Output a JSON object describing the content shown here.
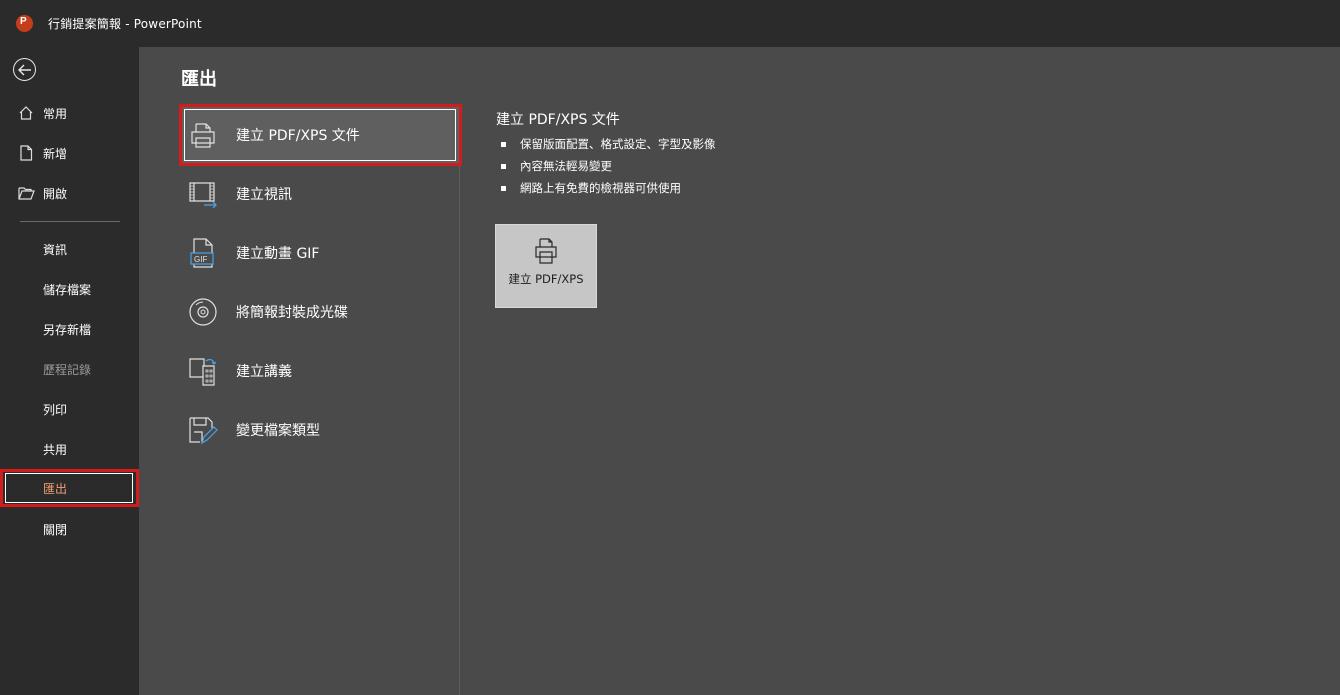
{
  "titlebar": {
    "title": "行銷提案簡報  -  PowerPoint"
  },
  "sidebar": {
    "items_top": [
      {
        "label": "常用",
        "icon": "home-icon"
      },
      {
        "label": "新增",
        "icon": "new-file-icon"
      },
      {
        "label": "開啟",
        "icon": "open-folder-icon"
      }
    ],
    "items": [
      {
        "label": "資訊",
        "state": "normal"
      },
      {
        "label": "儲存檔案",
        "state": "normal"
      },
      {
        "label": "另存新檔",
        "state": "normal"
      },
      {
        "label": "歷程記錄",
        "state": "disabled"
      },
      {
        "label": "列印",
        "state": "normal"
      },
      {
        "label": "共用",
        "state": "normal"
      },
      {
        "label": "匯出",
        "state": "active"
      },
      {
        "label": "關閉",
        "state": "normal"
      }
    ]
  },
  "main": {
    "title": "匯出",
    "options": [
      {
        "label": "建立 PDF/XPS 文件",
        "icon": "pdf-xps-icon",
        "selected": true
      },
      {
        "label": "建立視訊",
        "icon": "video-icon",
        "selected": false
      },
      {
        "label": "建立動畫 GIF",
        "icon": "gif-icon",
        "selected": false
      },
      {
        "label": "將簡報封裝成光碟",
        "icon": "cd-icon",
        "selected": false
      },
      {
        "label": "建立講義",
        "icon": "handout-icon",
        "selected": false
      },
      {
        "label": "變更檔案類型",
        "icon": "change-file-type-icon",
        "selected": false
      }
    ],
    "detail": {
      "title": "建立 PDF/XPS 文件",
      "bullets": [
        "保留版面配置、格式設定、字型及影像",
        "內容無法輕易變更",
        "網路上有免費的檢視器可供使用"
      ],
      "button_label": "建立 PDF/XPS"
    }
  },
  "colors": {
    "sidebar_bg": "#2b2b2b",
    "main_bg": "#4a4a4a",
    "highlight_box": "#d31c1c",
    "active_text": "#f0a070",
    "app_logo": "#c43e1c"
  }
}
